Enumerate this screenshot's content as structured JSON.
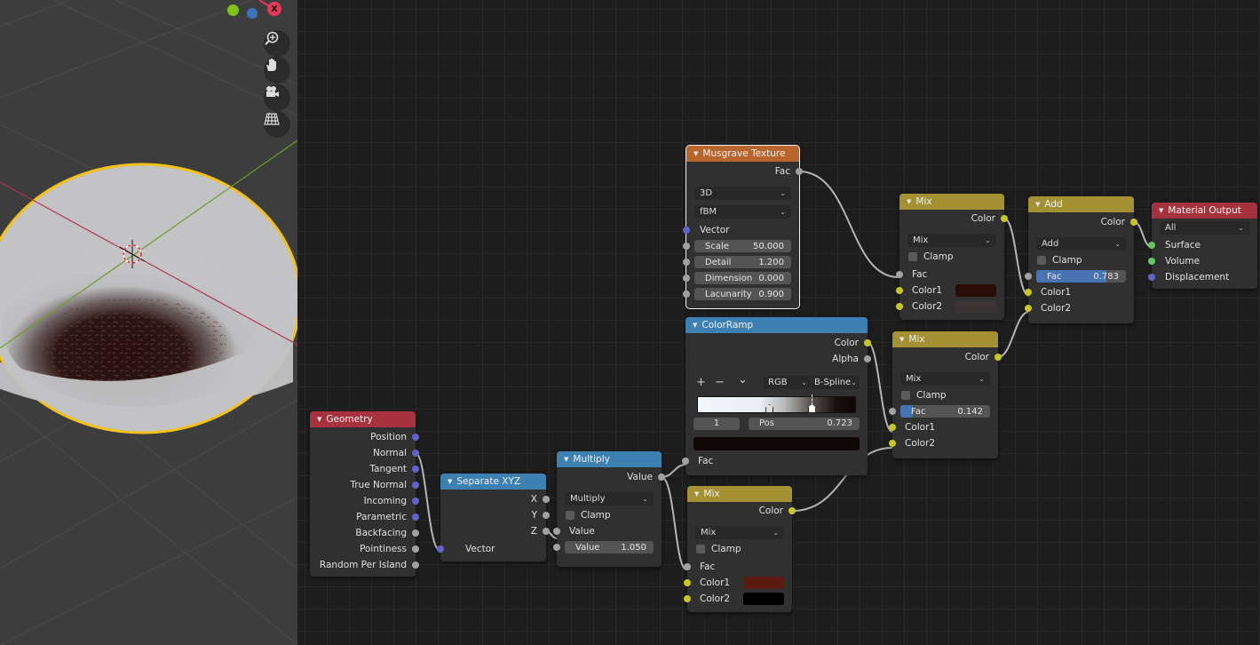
{
  "viewport": {
    "axis_gizmo": {
      "x_label": "X",
      "x_color": "#e8385a",
      "y_color": "#7fc218",
      "z_color": "#3c73b9"
    },
    "nav_buttons": [
      {
        "icon": "zoom-icon",
        "label": "Zoom"
      },
      {
        "icon": "hand-pan-icon",
        "label": "Pan"
      },
      {
        "icon": "camera-icon",
        "label": "Camera view"
      },
      {
        "icon": "grid-ortho-icon",
        "label": "Toggle orthographic"
      }
    ]
  },
  "nodes": {
    "musgrave": {
      "title": "Musgrave Texture",
      "header_color": "#b8652e",
      "output": "Fac",
      "dimensions": "3D",
      "type": "fBM",
      "vector_label": "Vector",
      "fields": [
        {
          "label": "Scale",
          "value": "50.000"
        },
        {
          "label": "Detail",
          "value": "1.200"
        },
        {
          "label": "Dimension",
          "value": "0.000"
        },
        {
          "label": "Lacunarity",
          "value": "0.900"
        }
      ]
    },
    "mix_top": {
      "title": "Mix",
      "header_color": "#a39133",
      "output": "Color",
      "blend": "Mix",
      "clamp": "Clamp",
      "inputs": [
        "Fac",
        "Color1",
        "Color2"
      ],
      "color1": "#2a0c06",
      "color2": "#3c3434"
    },
    "add": {
      "title": "Add",
      "header_color": "#a39133",
      "output": "Color",
      "blend": "Add",
      "clamp": "Clamp",
      "fac_label": "Fac",
      "fac_value": "0.783",
      "fac_fraction": 0.783,
      "inputs": [
        "Color1",
        "Color2"
      ]
    },
    "material_output": {
      "title": "Material Output",
      "header_color": "#a6323e",
      "target": "All",
      "inputs": [
        "Surface",
        "Volume",
        "Displacement"
      ]
    },
    "colorramp": {
      "title": "ColorRamp",
      "header_color": "#3d81b3",
      "outputs": [
        "Color",
        "Alpha"
      ],
      "add_btn": "+",
      "remove_btn": "−",
      "menu_btn": "⌄",
      "color_mode": "RGB",
      "interpolation": "B-Spline",
      "stops": [
        {
          "pos": 0.5,
          "color": "#f2f2f2"
        },
        {
          "pos": 0.723,
          "color": "#100606"
        }
      ],
      "active_index": "1",
      "pos_label": "Pos",
      "pos_value": "0.723",
      "active_color": "#100606",
      "input": "Fac"
    },
    "mix_mid": {
      "title": "Mix",
      "header_color": "#a39133",
      "output": "Color",
      "blend": "Mix",
      "clamp": "Clamp",
      "fac_label": "Fac",
      "fac_value": "0.142",
      "fac_fraction": 0.142,
      "inputs": [
        "Color1",
        "Color2"
      ]
    },
    "geometry": {
      "title": "Geometry",
      "header_color": "#a6323e",
      "outputs": [
        "Position",
        "Normal",
        "Tangent",
        "True Normal",
        "Incoming",
        "Parametric",
        "Backfacing",
        "Pointiness",
        "Random Per Island"
      ]
    },
    "separate_xyz": {
      "title": "Separate XYZ",
      "header_color": "#3d81b3",
      "outputs": [
        "X",
        "Y",
        "Z"
      ],
      "input": "Vector"
    },
    "multiply": {
      "title": "Multiply",
      "header_color": "#3d81b3",
      "output": "Value",
      "operation": "Multiply",
      "clamp": "Clamp",
      "input_label": "Value",
      "value_label": "Value",
      "value": "1.050"
    },
    "mix_bottom": {
      "title": "Mix",
      "header_color": "#a39133",
      "output": "Color",
      "blend": "Mix",
      "clamp": "Clamp",
      "inputs": [
        "Fac",
        "Color1",
        "Color2"
      ],
      "color1": "#5a1a10",
      "color2": "#000000"
    }
  }
}
